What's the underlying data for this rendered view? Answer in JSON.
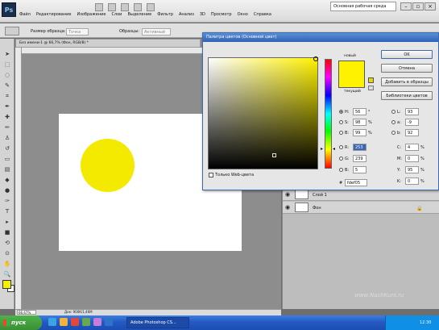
{
  "app": {
    "logo": "Ps",
    "workspace": "Основная рабочая среда"
  },
  "menu": [
    "Файл",
    "Редактирование",
    "Изображение",
    "Слои",
    "Выделение",
    "Фильтр",
    "Анализ",
    "3D",
    "Просмотр",
    "Окно",
    "Справка"
  ],
  "window_controls": {
    "minimize": "–",
    "restore": "▫",
    "close": "×"
  },
  "options": {
    "size_label": "Размер образца:",
    "size_value": "Точка",
    "samples_label": "Образцы:",
    "samples_value": "Активный"
  },
  "document": {
    "tab": "Без имени-1 @ 66,7% (Фон, RGB/8) *",
    "zoom": "66,67%",
    "info": "Док: 900K/1,46M"
  },
  "picker": {
    "title": "Палитра цветов (Основной цвет)",
    "new_label": "новый",
    "current_label": "текущий",
    "buttons": {
      "ok": "OK",
      "cancel": "Отмена",
      "add_swatch": "Добавить в образцы",
      "libraries": "Библиотеки цветов"
    },
    "web_only": "Только Web-цвета",
    "new_color": "#fff200",
    "fields": {
      "H": "56",
      "S": "98",
      "B": "99",
      "R": "253",
      "G": "239",
      "Bb": "5",
      "L": "93",
      "a": "-9",
      "b": "92",
      "C": "4",
      "M": "0",
      "Y": "95",
      "K": "0",
      "hex": "fdef05"
    },
    "units": {
      "deg": "°",
      "pct": "%"
    },
    "field_labels": {
      "H": "H:",
      "S": "S:",
      "B": "B:",
      "R": "R:",
      "G": "G:",
      "Bb": "B:",
      "L": "L:",
      "a": "a:",
      "b": "b:",
      "C": "C:",
      "M": "M:",
      "Y": "Y:",
      "K": "K:",
      "hex": "#"
    }
  },
  "layers": [
    {
      "name": "Слой 1"
    },
    {
      "name": "Фон"
    }
  ],
  "watermark": "www.NashKurs.ru",
  "taskbar": {
    "start": "пуск",
    "app": "Adobe Photoshop CS...",
    "clock": "12:30"
  },
  "colors": {
    "foreground": "#f4f000",
    "background": "#ffffff",
    "circle": "#f3ea00"
  }
}
